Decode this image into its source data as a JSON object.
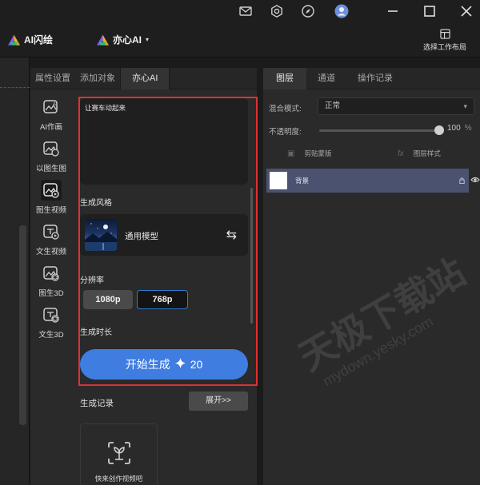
{
  "toolbar": {
    "brand1": "AI闪绘",
    "brand2": "亦心AI",
    "layout_label": "选择工作布局"
  },
  "left_panel": {
    "tabs": [
      {
        "label": "属性设置"
      },
      {
        "label": "添加对象"
      },
      {
        "label": "亦心AI"
      }
    ],
    "tools": [
      {
        "label": "AI作画",
        "icon": "image-ai-icon"
      },
      {
        "label": "以图生图",
        "icon": "image-to-image-icon"
      },
      {
        "label": "图生视频",
        "icon": "image-to-video-icon"
      },
      {
        "label": "文生视频",
        "icon": "text-to-video-icon"
      },
      {
        "label": "图生3D",
        "icon": "image-to-3d-icon"
      },
      {
        "label": "文生3D",
        "icon": "text-to-3d-icon"
      }
    ],
    "prompt_text": "让赛车动起来",
    "style_label": "生成风格",
    "model_name": "通用模型",
    "swap_glyph": "⇆",
    "resolution_label": "分辨率",
    "resolutions": [
      "1080p",
      "768p"
    ],
    "selected_resolution": "768p",
    "duration_label": "生成时长",
    "generate_label": "开始生成",
    "generate_cost": "20",
    "generate_icon": "sparkle-icon",
    "history_label": "生成记录",
    "expand_label": "展开>>",
    "history_empty_text": "快来创作视频吧"
  },
  "right_panel": {
    "tabs": [
      {
        "label": "图层"
      },
      {
        "label": "通道"
      },
      {
        "label": "操作记录"
      }
    ],
    "blend_mode_label": "混合模式:",
    "blend_mode_value": "正常",
    "opacity_label": "不透明度:",
    "opacity_value": "100",
    "opacity_unit": "%",
    "opacity_fraction": 1.0,
    "clip_mask_label": "剪贴蒙版",
    "layer_style_label": "图层样式",
    "layers": [
      {
        "name": "背景",
        "locked": true,
        "visible": true
      }
    ]
  },
  "watermark": {
    "text": "天极下载站",
    "url": "mydown.yesky.com"
  },
  "colors": {
    "accent_blue": "#3f7de0",
    "highlight_red": "#e03131",
    "selected_layer": "#4a5270"
  }
}
